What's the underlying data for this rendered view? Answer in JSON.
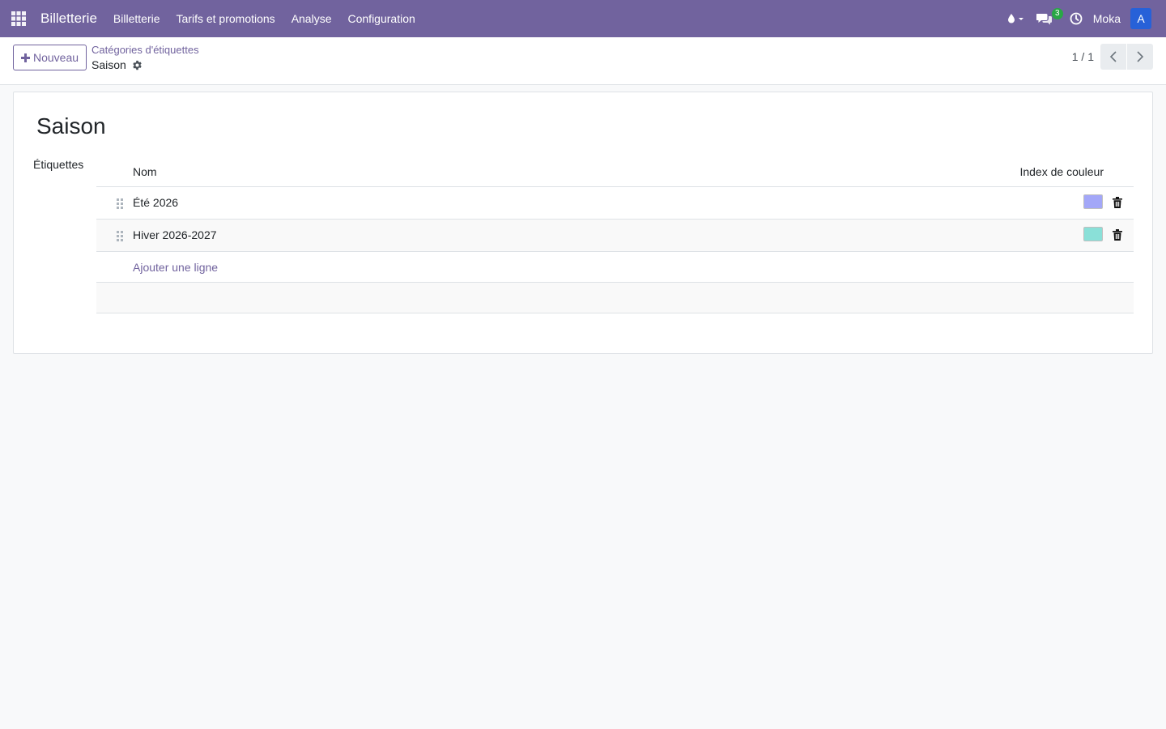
{
  "navbar": {
    "app_name": "Billetterie",
    "menu": [
      "Billetterie",
      "Tarifs et promotions",
      "Analyse",
      "Configuration"
    ],
    "messages_count": "3",
    "company": "Moka",
    "avatar_initial": "A",
    "colors": {
      "navbar": "#71639e",
      "avatar": "#2761d8",
      "badge": "#28a745"
    }
  },
  "control_panel": {
    "new_button": "Nouveau",
    "breadcrumb_parent": "Catégories d'étiquettes",
    "breadcrumb_current": "Saison",
    "pager": "1 / 1"
  },
  "form": {
    "title": "Saison",
    "tags_label": "Étiquettes",
    "columns": {
      "name": "Nom",
      "color": "Index de couleur"
    },
    "rows": [
      {
        "name": "Été 2026",
        "color": "#a3a7f8"
      },
      {
        "name": "Hiver 2026-2027",
        "color": "#8ae0d8"
      }
    ],
    "add_line": "Ajouter une ligne"
  }
}
